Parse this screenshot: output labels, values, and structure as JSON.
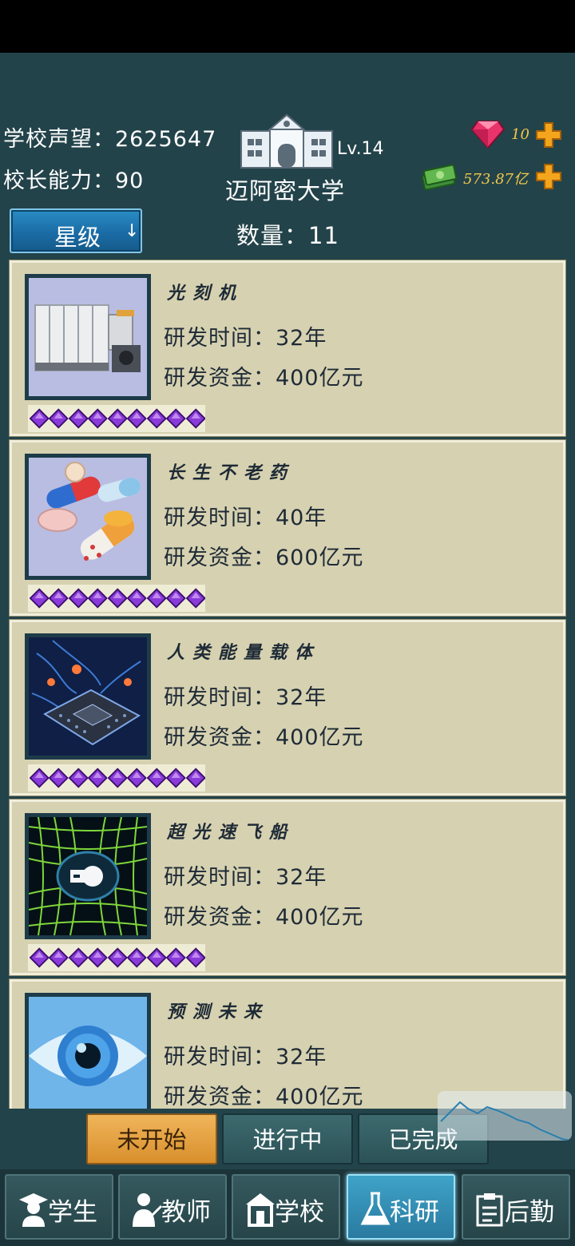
{
  "header": {
    "reputation_label": "学校声望：2625647",
    "ability_label": "校长能力：90",
    "school_level": "Lv.14",
    "school_name": "迈阿密大学",
    "gems": "10",
    "money": "573.87亿"
  },
  "toolbar": {
    "sort_label": "星级",
    "sort_arrow": "↓",
    "count_label": "数量：11"
  },
  "research_items": [
    {
      "title": "光刻机",
      "time": "研发时间：32年",
      "fund": "研发资金：400亿元",
      "stars": 9,
      "image": "lithography-machine"
    },
    {
      "title": "长生不老药",
      "time": "研发时间：40年",
      "fund": "研发资金：600亿元",
      "stars": 9,
      "image": "pills"
    },
    {
      "title": "人类能量载体",
      "time": "研发时间：32年",
      "fund": "研发资金：400亿元",
      "stars": 9,
      "image": "chip"
    },
    {
      "title": "超光速飞船",
      "time": "研发时间：32年",
      "fund": "研发资金：400亿元",
      "stars": 9,
      "image": "warp-grid"
    },
    {
      "title": "预测未来",
      "time": "研发时间：32年",
      "fund": "研发资金：400亿元",
      "stars": 9,
      "image": "eye"
    }
  ],
  "status_tabs": [
    {
      "label": "未开始",
      "active": true
    },
    {
      "label": "进行中",
      "active": false
    },
    {
      "label": "已完成",
      "active": false
    }
  ],
  "nav": [
    {
      "label": "学生",
      "icon": "student-icon",
      "active": false
    },
    {
      "label": "教师",
      "icon": "teacher-icon",
      "active": false
    },
    {
      "label": "学校",
      "icon": "school-icon",
      "active": false
    },
    {
      "label": "科研",
      "icon": "flask-icon",
      "active": true
    },
    {
      "label": "后勤",
      "icon": "clipboard-icon",
      "active": false
    }
  ],
  "colors": {
    "accent_orange": "#f0b55a",
    "active_blue": "#3fa3c8",
    "card_bg": "#d6d1b0",
    "gem_value": "#f2c94c"
  }
}
